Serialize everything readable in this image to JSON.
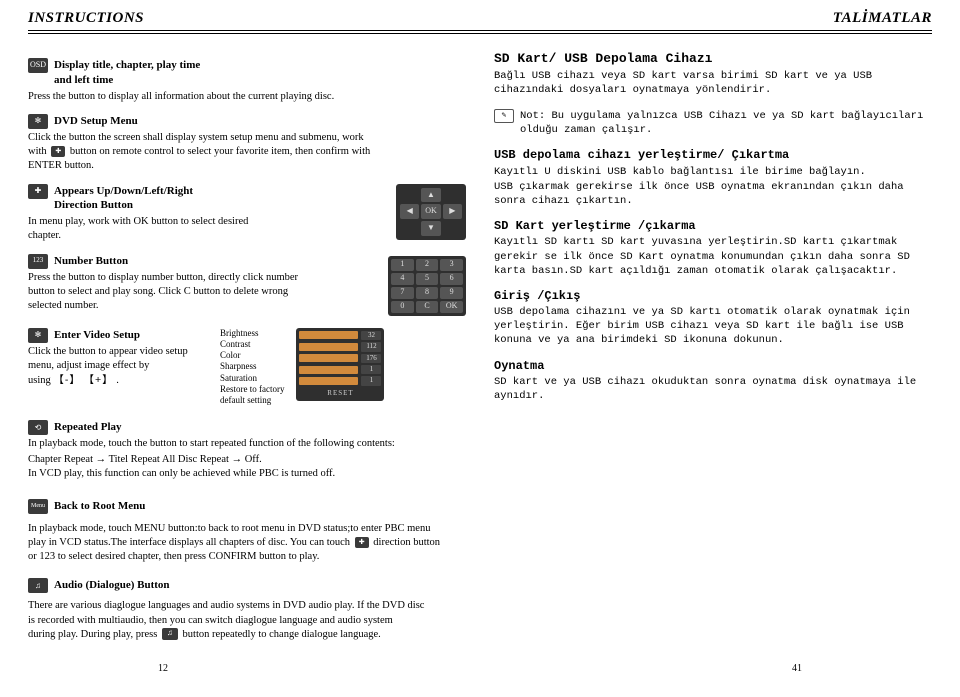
{
  "header": {
    "left": "INSTRUCTIONS",
    "right": "TALİMATLAR"
  },
  "left": {
    "osd": {
      "icon": "OSD",
      "title_l1": "Display title, chapter, play time",
      "title_l2": "and left time",
      "body": "Press the button to display all information about the current playing disc."
    },
    "setup": {
      "icon": "✻",
      "title": "DVD Setup Menu",
      "body1": "Click the button the screen shall display system setup menu and submenu, work",
      "body2_pre": "with ",
      "body2_post": " button on remote control to select your favorite item, then confirm with",
      "body3": "ENTER button."
    },
    "dir": {
      "icon": "✚",
      "title_l1": "Appears Up/Down/Left/Right",
      "title_l2": "Direction Button",
      "body": "In menu play, work with OK button to select desired chapter.",
      "keys": [
        "",
        "▲",
        "",
        "◀",
        "OK",
        "▶",
        "",
        "▼",
        ""
      ]
    },
    "num": {
      "icon": "123",
      "title": "Number Button",
      "body": "Press the button to display number button, directly click number button to select and play song. Click C button to delete wrong selected number.",
      "keys": [
        "1",
        "2",
        "3",
        "4",
        "5",
        "6",
        "7",
        "8",
        "9",
        "0",
        "C",
        "OK"
      ]
    },
    "video": {
      "icon": "✻",
      "title": "Enter Video Setup",
      "body1": "Click the button to appear video setup menu, adjust image effect by",
      "body2_pre": "using",
      "body2_minus": "【-】",
      "body2_plus": "【+】",
      "body2_post": ".",
      "labels": [
        "Brightness",
        "Contrast",
        "Color",
        "Sharpness",
        "Saturation",
        "Restore to factory",
        "default setting"
      ],
      "vals": [
        "32",
        "112",
        "176",
        "1",
        "1"
      ],
      "reset": "RESET"
    },
    "repeat": {
      "icon": "⟲",
      "title": "Repeated Play",
      "l1": "In playback mode, touch the button to start repeated function of the following contents:",
      "l2a": "Chapter Repeat ",
      "l2b": " Titel Repeat  All Disc Repeat ",
      "l2c": " Off.",
      "l3": "In VCD play, this function can only be achieved while PBC is turned off."
    },
    "rootmenu": {
      "icon": "Menu",
      "title": "Back to Root Menu",
      "l1": "In playback mode, touch MENU button:to back to root menu in DVD status;to enter PBC menu",
      "l2a": " play in VCD status.The interface displays all chapters of disc. You can touch ",
      "l2b": " direction button",
      "l3": "or 123 to select desired chapter, then press CONFIRM button to play."
    },
    "audio": {
      "icon": "♫",
      "title": "Audio (Dialogue) Button",
      "l1": "There are various diaglogue languages and audio systems in DVD audio play. If the DVD disc",
      "l2": " is recorded with multiaudio, then you can switch diaglogue language and audio system",
      "l3a": "during play. During play, press ",
      "l3b": " button repeatedly to change dialogue language."
    }
  },
  "right": {
    "h1": "SD Kart/ USB Depolama Cihazı",
    "p1": "Bağlı USB cihazı veya SD kart varsa birimi SD kart ve ya USB cihazındaki dosyaları oynatmaya yönlendirir.",
    "note": "Not: Bu uygulama yalnızca USB Cihazı ve ya SD kart bağlayıcıları olduğu zaman çalışır.",
    "h2": "USB depolama cihazı yerleştirme/ Çıkartma",
    "p2a": "Kayıtlı U diskini USB kablo bağlantısı ile birime bağlayın.",
    "p2b": "USB çıkarmak gerekirse ilk önce USB oynatma ekranından çıkın daha sonra cihazı çıkartın.",
    "h3": "SD Kart yerleştirme /çıkarma",
    "p3": "Kayıtlı SD kartı SD kart yuvasına yerleştirin.SD kartı çıkartmak gerekir se ilk önce SD Kart oynatma konumundan çıkın daha sonra SD karta basın.SD kart açıldığı zaman otomatik olarak çalışacaktır.",
    "h4": "Giriş /Çıkış",
    "p4": "USB depolama cihazını ve ya SD kartı otomatik olarak oynatmak için yerleştirin. Eğer birim USB cihazı veya SD kart ile bağlı ise USB konuna ve ya ana birimdeki SD ikonuna dokunun.",
    "h5": "Oynatma",
    "p5": "SD kart ve ya USB cihazı okuduktan sonra oynatma disk oynatmaya ile aynıdır."
  },
  "pages": {
    "left": "12",
    "right": "41"
  }
}
